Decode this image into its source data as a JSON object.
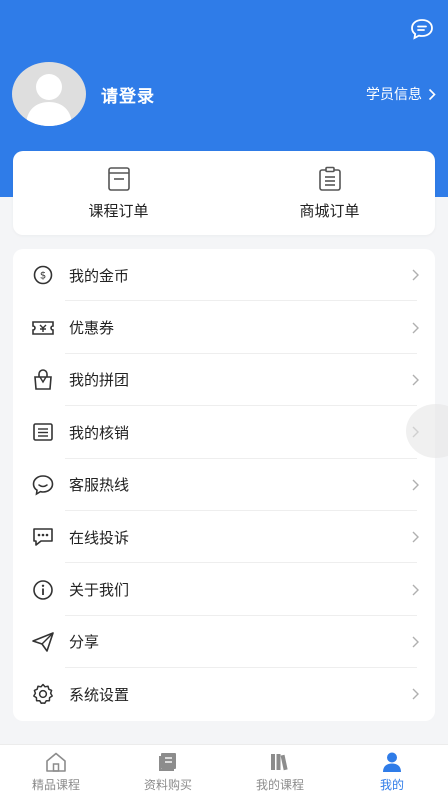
{
  "colors": {
    "brand": "#2f7ce8",
    "icon": "#333333",
    "chevron": "#b0b0b0",
    "tab_inactive": "#8c8c8c"
  },
  "header": {
    "login_text": "请登录",
    "student_info_label": "学员信息",
    "message_icon": "chat-bubble-icon"
  },
  "orders": [
    {
      "label": "课程订单",
      "icon": "course-order-icon"
    },
    {
      "label": "商城订单",
      "icon": "mall-order-icon"
    }
  ],
  "menu": [
    {
      "label": "我的金币",
      "icon": "coin-icon"
    },
    {
      "label": "优惠券",
      "icon": "coupon-icon"
    },
    {
      "label": "我的拼团",
      "icon": "group-buy-icon"
    },
    {
      "label": "我的核销",
      "icon": "verification-icon"
    },
    {
      "label": "客服热线",
      "icon": "customer-service-icon"
    },
    {
      "label": "在线投诉",
      "icon": "complaint-icon"
    },
    {
      "label": "关于我们",
      "icon": "info-icon"
    },
    {
      "label": "分享",
      "icon": "share-icon"
    },
    {
      "label": "系统设置",
      "icon": "settings-icon"
    }
  ],
  "tabbar": [
    {
      "label": "精品课程",
      "icon": "home-icon",
      "active": false
    },
    {
      "label": "资料购买",
      "icon": "book-icon",
      "active": false
    },
    {
      "label": "我的课程",
      "icon": "bookshelf-icon",
      "active": false
    },
    {
      "label": "我的",
      "icon": "user-icon",
      "active": true
    }
  ]
}
